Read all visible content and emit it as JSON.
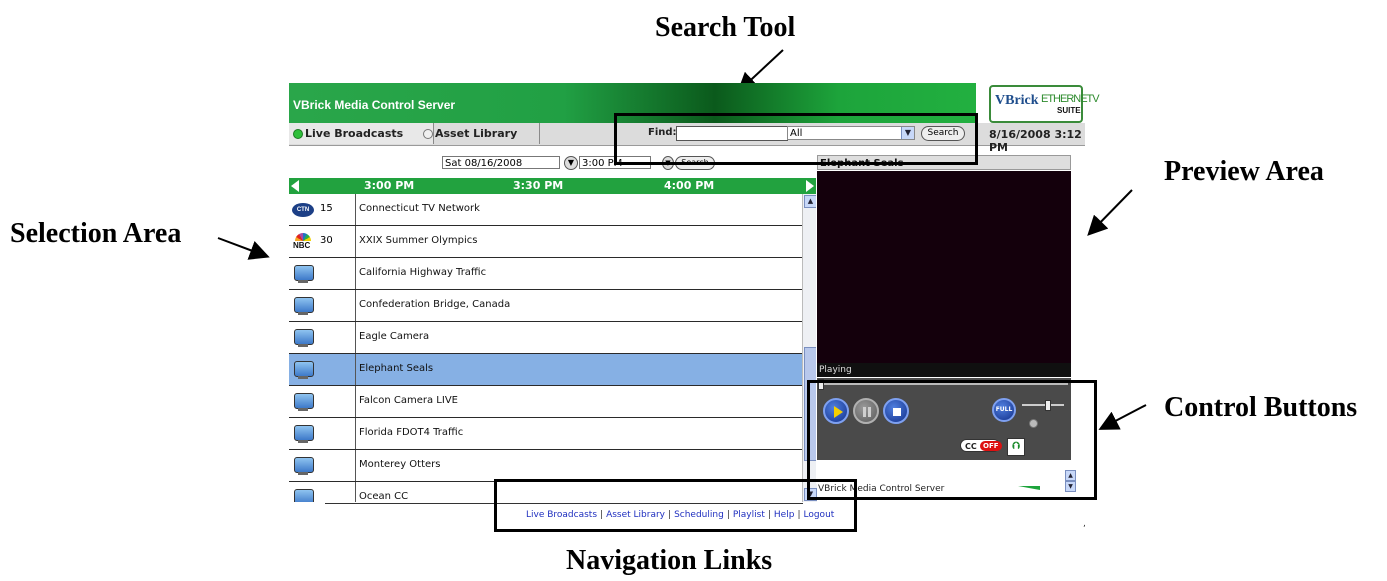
{
  "callouts": {
    "search_tool": "Search Tool",
    "preview_area": "Preview Area",
    "selection_area": "Selection Area",
    "control_buttons": "Control Buttons",
    "navigation_links": "Navigation Links"
  },
  "header": {
    "title": "VBrick Media Control Server",
    "logo_main": "VBrick",
    "logo_sub": "ETHERNETV",
    "logo_suite": "SUITE"
  },
  "tabs": [
    {
      "label": "Live Broadcasts",
      "active": true
    },
    {
      "label": "Asset Library",
      "active": false
    }
  ],
  "search": {
    "label": "Find:",
    "value": "",
    "category": "All",
    "button": "Search"
  },
  "datetime": "8/16/2008 3:12 PM",
  "date_filter": {
    "date": "Sat 08/16/2008",
    "time": "3:00 PM",
    "button": "Search"
  },
  "timeline": [
    "3:00 PM",
    "3:30 PM",
    "4:00 PM"
  ],
  "channels": [
    {
      "icon": "ctn-logo-icon",
      "logo_text": "CTN",
      "number": "15",
      "name": "Connecticut TV Network"
    },
    {
      "icon": "nbc-logo-icon",
      "logo_text": "NBC",
      "number": "30",
      "name": "XXIX Summer Olympics"
    },
    {
      "icon": "monitor-icon",
      "number": "",
      "name": "California Highway Traffic"
    },
    {
      "icon": "monitor-icon",
      "number": "",
      "name": "Confederation Bridge, Canada"
    },
    {
      "icon": "monitor-icon",
      "number": "",
      "name": "Eagle Camera"
    },
    {
      "icon": "monitor-icon",
      "number": "",
      "name": "Elephant Seals",
      "selected": true
    },
    {
      "icon": "monitor-icon",
      "number": "",
      "name": "Falcon Camera LIVE"
    },
    {
      "icon": "monitor-icon",
      "number": "",
      "name": "Florida FDOT4 Traffic"
    },
    {
      "icon": "monitor-icon",
      "number": "",
      "name": "Monterey Otters"
    },
    {
      "icon": "monitor-icon",
      "number": "",
      "name": "Ocean CC"
    }
  ],
  "preview": {
    "title": "Elephant Seals",
    "status": "Playing",
    "progress": 0.0,
    "volume": 0.6,
    "full_label": "FULL",
    "cc_label": "CC",
    "cc_state": "OFF"
  },
  "server_label": "VBrick Media Control Server",
  "footer": {
    "links": [
      "Live Broadcasts",
      "Asset Library",
      "Scheduling",
      "Playlist",
      "Help",
      "Logout"
    ],
    "mark": ","
  },
  "colors": {
    "header_green": "#22a23f",
    "selected_row": "#86b0e4",
    "video_bg": "#14000c",
    "link_blue": "#1f2fbf"
  }
}
